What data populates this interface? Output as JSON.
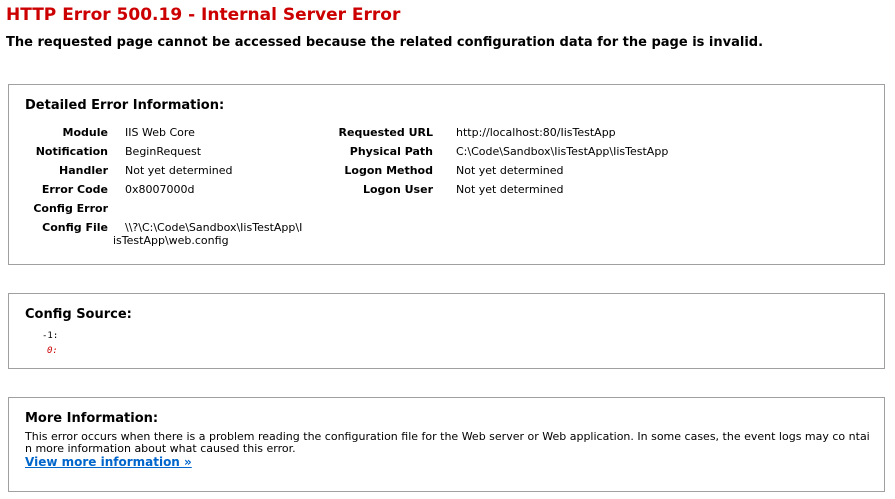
{
  "error": {
    "title": "HTTP Error 500.19 - Internal Server Error",
    "subtitle": "The requested page cannot be accessed because the related configuration data for the page is invalid."
  },
  "detailed": {
    "heading": "Detailed Error Information:",
    "left": [
      {
        "label": "Module",
        "value": "IIS Web Core"
      },
      {
        "label": "Notification",
        "value": "BeginRequest"
      },
      {
        "label": "Handler",
        "value": "Not yet determined"
      },
      {
        "label": "Error Code",
        "value": "0x8007000d"
      },
      {
        "label": "Config Error",
        "value": ""
      },
      {
        "label": "Config File",
        "value_line1": "\\\\?\\C:\\Code\\Sandbox\\IisTestApp\\I",
        "value_line2": "isTestApp\\web.config"
      }
    ],
    "right": [
      {
        "label": "Requested URL",
        "value": "http://localhost:80/IisTestApp"
      },
      {
        "label": "Physical Path",
        "value": "C:\\Code\\Sandbox\\IisTestApp\\IisTestApp"
      },
      {
        "label": "Logon Method",
        "value": "Not yet determined"
      },
      {
        "label": "Logon User",
        "value": "Not yet determined"
      }
    ]
  },
  "config_source": {
    "heading": "Config Source:",
    "lines": [
      "-1:",
      "0:"
    ]
  },
  "more_info": {
    "heading": "More Information:",
    "text": "This error occurs when there is a problem reading the configuration file for the Web server or Web application. In some cases, the event logs may co ntain more information about what caused this error.",
    "link": "View more information »"
  },
  "colors": {
    "title": "#cc0000",
    "link": "#0066cc",
    "border": "#a0a0a0"
  }
}
